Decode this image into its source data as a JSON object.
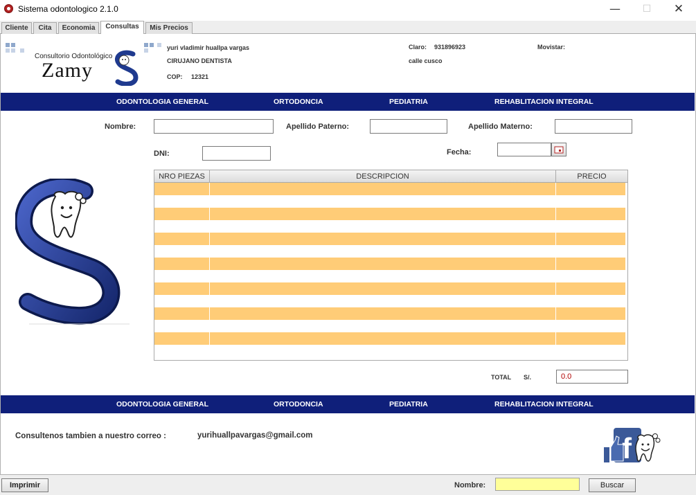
{
  "window": {
    "title": "Sistema odontologico 2.1.0",
    "minimize_glyph": "—",
    "maximize_glyph": "☐",
    "close_glyph": "✕"
  },
  "tabs": [
    {
      "label": "Cliente",
      "active": false
    },
    {
      "label": "Cita",
      "active": false
    },
    {
      "label": "Economia",
      "active": false
    },
    {
      "label": "Consultas",
      "active": true
    },
    {
      "label": "Mis Precios",
      "active": false
    }
  ],
  "header": {
    "logo_small_text": "Consultorio Odontológico",
    "logo_brand": "Zamy",
    "doctor_name": "yuri vladimir huallpa  vargas",
    "doctor_title": "CIRUJANO DENTISTA",
    "cop_label": "COP:",
    "cop_value": "12321",
    "claro_label": "Claro:",
    "claro_value": "931896923",
    "movistar_label": "Movistar:",
    "address": "calle cusco"
  },
  "services_bar": [
    "ODONTOLOGIA GENERAL",
    "ORTODONCIA",
    "PEDIATRIA",
    "REHABLITACION INTEGRAL"
  ],
  "form": {
    "nombre_label": "Nombre:",
    "nombre_value": "",
    "apellido_paterno_label": "Apellido Paterno:",
    "apellido_paterno_value": "",
    "apellido_materno_label": "Apellido Materno:",
    "apellido_materno_value": "",
    "dni_label": "DNI:",
    "dni_value": "",
    "fecha_label": "Fecha:",
    "fecha_value": ""
  },
  "table": {
    "columns": [
      "NRO PIEZAS",
      "DESCRIPCION",
      "PRECIO"
    ],
    "rows": [
      [
        "",
        "",
        ""
      ],
      [
        "",
        "",
        ""
      ],
      [
        "",
        "",
        ""
      ],
      [
        "",
        "",
        ""
      ],
      [
        "",
        "",
        ""
      ],
      [
        "",
        "",
        ""
      ],
      [
        "",
        "",
        ""
      ],
      [
        "",
        "",
        ""
      ],
      [
        "",
        "",
        ""
      ],
      [
        "",
        "",
        ""
      ],
      [
        "",
        "",
        ""
      ],
      [
        "",
        "",
        ""
      ],
      [
        "",
        "",
        ""
      ],
      [
        "",
        "",
        ""
      ]
    ]
  },
  "total": {
    "label": "TOTAL",
    "currency": "S/.",
    "value": "0.0"
  },
  "footer": {
    "contact_label": "Consultenos tambien a nuestro correo :",
    "email": "yurihuallpavargas@gmail.com"
  },
  "statusbar": {
    "print_button": "Imprimir",
    "search_label": "Nombre:",
    "search_value": "",
    "search_button": "Buscar"
  },
  "colors": {
    "bar_blue": "#0f1f7a",
    "row_orange": "#ffcc77",
    "logo_blue": "#1f3a8f",
    "total_red": "#b00000",
    "search_yellow": "#ffff99"
  },
  "icons": {
    "app": "tooth-app-icon",
    "calendar": "calendar-icon",
    "facebook": "facebook-like-icon",
    "logo": "zamy-s-logo"
  }
}
